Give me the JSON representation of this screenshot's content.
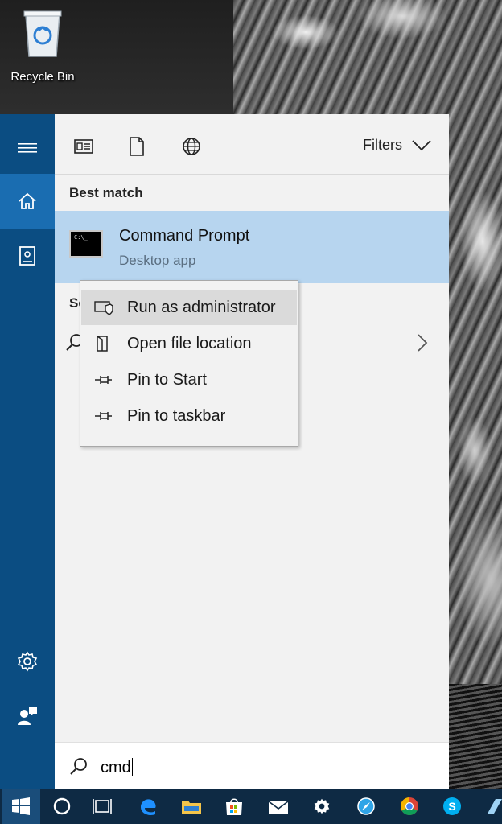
{
  "desktop": {
    "recycle_bin_label": "Recycle Bin"
  },
  "start_menu": {
    "toolbar": {
      "filters_label": "Filters"
    },
    "best_match_header": "Best match",
    "best_match": {
      "title": "Command Prompt",
      "subtitle": "Desktop app"
    },
    "partial_section_header": "Se",
    "search": {
      "query": "cmd"
    }
  },
  "context_menu": {
    "items": [
      {
        "label": "Run as administrator",
        "icon": "shield-icon"
      },
      {
        "label": "Open file location",
        "icon": "folder-location-icon"
      },
      {
        "label": "Pin to Start",
        "icon": "pin-icon"
      },
      {
        "label": "Pin to taskbar",
        "icon": "pin-icon"
      }
    ]
  },
  "taskbar": {
    "items": [
      "windows-start-icon",
      "cortana-icon",
      "task-view-icon",
      "edge-icon",
      "file-explorer-icon",
      "store-icon",
      "mail-icon",
      "settings-icon",
      "safari-icon",
      "chrome-icon",
      "skype-icon",
      "app-icon"
    ]
  },
  "colors": {
    "rail": "#0b4d82",
    "rail_active": "#1a6db1",
    "best_match_highlight": "#b7d5ef",
    "taskbar": "#0e2a44"
  }
}
